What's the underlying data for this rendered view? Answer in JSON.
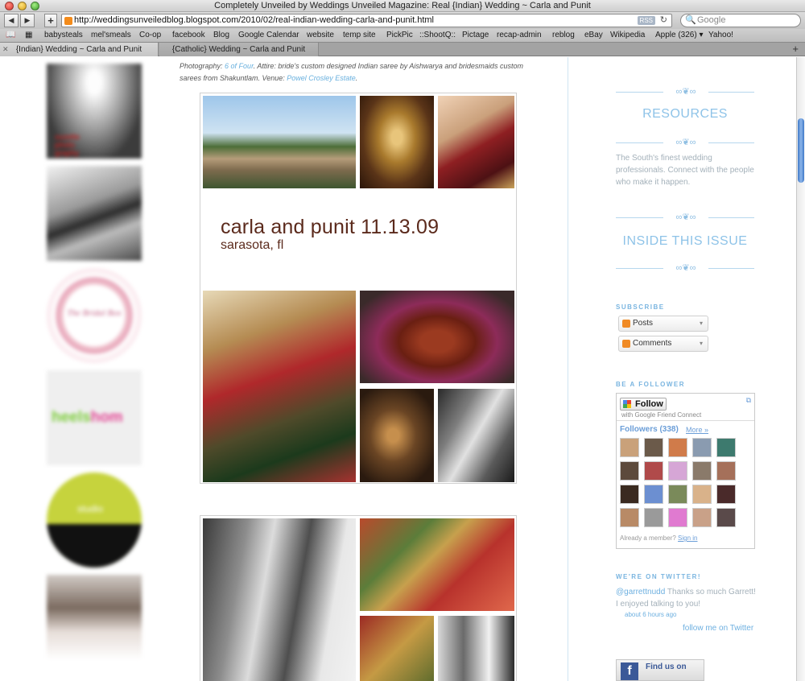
{
  "window": {
    "title": "Completely Unveiled by Weddings Unveiled Magazine: Real {Indian} Wedding ~ Carla and Punit"
  },
  "toolbar": {
    "back_label": "◀",
    "forward_label": "▶",
    "add_label": "+",
    "url": "http://weddingsunveiledblog.blogspot.com/2010/02/real-indian-wedding-carla-and-punit.html",
    "rss_label": "RSS",
    "reload_label": "↻",
    "search_placeholder": "Google"
  },
  "bookmarks": {
    "reader_icon": "📖",
    "grid_icon": "▦",
    "items": [
      "babysteals",
      "mel'smeals",
      "Co-op",
      "facebook",
      "Blog",
      "Google Calendar",
      "website",
      "temp site",
      "PickPic",
      "::ShootQ::",
      "Pictage",
      "recap-admin",
      "reblog",
      "eBay",
      "Wikipedia",
      "Apple (326) ▾",
      "Yahoo!"
    ]
  },
  "tabs": [
    {
      "label": "{Indian} Wedding ~ Carla and Punit",
      "active": true
    },
    {
      "label": "{Catholic} Wedding ~ Carla and Punit",
      "active": false
    }
  ],
  "tab_close": "✕",
  "tab_add": "+",
  "sponsors": {
    "sp1_text": "suzette\nphoto\ngraphy",
    "sp3_text": "The Bridal Box",
    "sp4_text_a": "heels",
    "sp4_text_b": "hom",
    "sp5_text": "studio"
  },
  "post": {
    "caption_a": "Photography: ",
    "caption_link1": "6 of Four",
    "caption_b": ". Attire: bride's custom designed Indian saree by Aishwarya and bridesmaids custom sarees from Shakuntlam. Venue: ",
    "caption_link2": "Powel Crosley Estate",
    "caption_c": ".",
    "names": "carla and punit 11.13.09",
    "location": "sarasota, fl"
  },
  "sidebar": {
    "ornament": "∞❦∞",
    "resources_title": "RESOURCES",
    "resources_text": "The South's finest wedding professionals. Connect with the people who make it happen.",
    "issue_title": "INSIDE THIS ISSUE",
    "subscribe_heading": "SUBSCRIBE",
    "posts_label": "Posts",
    "comments_label": "Comments",
    "dropdown_icon": "▾",
    "follower_heading": "BE A FOLLOWER",
    "follow_label": "Follow",
    "gfc_sub": "with Google Friend Connect",
    "gfc_ext": "⧉",
    "followers_label": "Followers (338)",
    "more_label": "More »",
    "member_text": "Already a member?",
    "sign_in": "Sign in",
    "twitter_heading": "WE'RE ON TWITTER!",
    "tweet_user": "@garrettnudd",
    "tweet_text": " Thanks so much Garrett! I enjoyed talking to you!",
    "tweet_time": "about 6 hours ago",
    "twitter_follow": "follow me on Twitter",
    "fb_icon": "f",
    "fb_label": "Find us on"
  },
  "colors": {
    "accent_blue": "#8ec3e8",
    "title_brown": "#5b2a1c",
    "link_blue": "#6eb0e0"
  }
}
